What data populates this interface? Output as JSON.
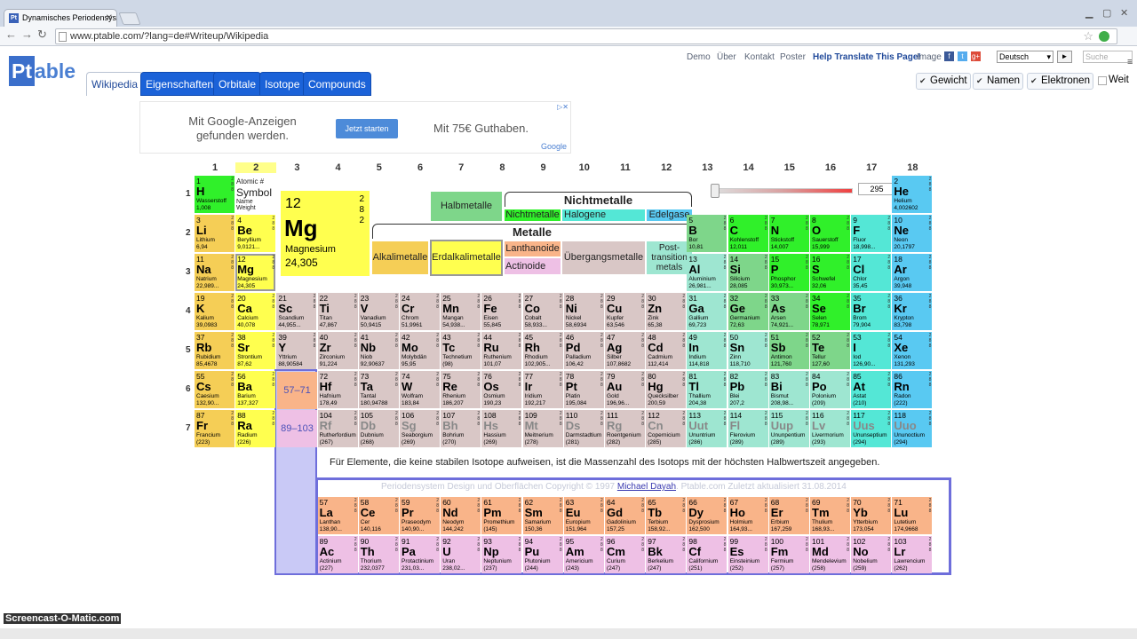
{
  "browser": {
    "tab_title": "Dynamisches Periodensys",
    "url": "www.ptable.com/?lang=de#Writeup/Wikipedia"
  },
  "logo": {
    "pt": "Pt",
    "rest": "able"
  },
  "nav_tabs": [
    "Wikipedia",
    "Eigenschaften",
    "Orbitale",
    "Isotope",
    "Compounds"
  ],
  "top_links": [
    "Demo",
    "Über",
    "Kontakt",
    "Poster",
    "Help Translate This Page!",
    "Image"
  ],
  "language": "Deutsch",
  "search_placeholder": "Suche",
  "toggles": [
    {
      "label": "Gewicht",
      "checked": true
    },
    {
      "label": "Namen",
      "checked": true
    },
    {
      "label": "Elektronen",
      "checked": true
    },
    {
      "label": "Weit",
      "checked": false
    }
  ],
  "ad": {
    "line1": "Mit Google-Anzeigen gefunden werden.",
    "button": "Jetzt starten",
    "line2": "Mit 75€ Guthaben.",
    "brand": "Google"
  },
  "groups": [
    "1",
    "2",
    "3",
    "4",
    "5",
    "6",
    "7",
    "8",
    "9",
    "10",
    "11",
    "12",
    "13",
    "14",
    "15",
    "16",
    "17",
    "18"
  ],
  "periods": [
    "1",
    "2",
    "3",
    "4",
    "5",
    "6",
    "7"
  ],
  "legend": {
    "atomic": "Atomic #",
    "symbol": "Symbol",
    "name": "Name",
    "weight": "Weight",
    "big_number": "12",
    "big_symbol": "Mg",
    "big_name": "Magnesium",
    "big_weight": "24,305",
    "big_shells": "2\n8\n2",
    "nichtmetalle": "Nichtmetalle",
    "metalle": "Metalle",
    "halbmetalle": "Halbmetalle",
    "nichtmetall": "Nichtmetalle",
    "halogene": "Halogene",
    "edelgase": "Edelgase",
    "alkali": "Alkalimetalle",
    "erdalkali": "Erdalkalimetalle",
    "lanthanoide": "Lanthanoide",
    "actinoide": "Actinoide",
    "uebergang": "Übergangsmetalle",
    "post": "Post-transition metals",
    "temp": "295"
  },
  "placeholders": [
    "57–71",
    "89–103"
  ],
  "note": "Für Elemente, die keine stabilen Isotope aufweisen, ist die Massenzahl des Isotops mit der höchsten Halbwertszeit angegeben.",
  "copyright": {
    "pre": "Periodensystem Design und Oberflächen Copyright © 1997",
    "author": "Michael Dayah",
    "post": ". Ptable.com Zuletzt aktualisiert 31.08.2014"
  },
  "watermark": "Screencast-O-Matic.com",
  "elements": [
    [
      "1",
      "H",
      "Wasserstoff",
      "1,008",
      1,
      1,
      "nm2",
      false
    ],
    [
      "2",
      "He",
      "Helium",
      "4,002602",
      18,
      1,
      "ng",
      false
    ],
    [
      "3",
      "Li",
      "Lithium",
      "6,94",
      1,
      2,
      "alk",
      false
    ],
    [
      "4",
      "Be",
      "Beryllium",
      "9,0121...",
      2,
      2,
      "ea",
      false
    ],
    [
      "5",
      "B",
      "Bor",
      "10,81",
      13,
      2,
      "ml",
      false
    ],
    [
      "6",
      "C",
      "Kohlenstoff",
      "12,011",
      14,
      2,
      "nm2",
      false
    ],
    [
      "7",
      "N",
      "Stickstoff",
      "14,007",
      15,
      2,
      "nm2",
      false
    ],
    [
      "8",
      "O",
      "Sauerstoff",
      "15,999",
      16,
      2,
      "nm2",
      false
    ],
    [
      "9",
      "F",
      "Fluor",
      "18,998...",
      17,
      2,
      "hal",
      false
    ],
    [
      "10",
      "Ne",
      "Neon",
      "20,1797",
      18,
      2,
      "ng",
      false
    ],
    [
      "11",
      "Na",
      "Natrium",
      "22,989...",
      1,
      3,
      "alk",
      false
    ],
    [
      "12",
      "Mg",
      "Magnesium",
      "24,305",
      2,
      3,
      "ea",
      false
    ],
    [
      "13",
      "Al",
      "Aluminium",
      "26,981...",
      13,
      3,
      "pt2",
      false
    ],
    [
      "14",
      "Si",
      "Silicium",
      "28,085",
      14,
      3,
      "ml",
      false
    ],
    [
      "15",
      "P",
      "Phosphor",
      "30,973...",
      15,
      3,
      "nm2",
      false
    ],
    [
      "16",
      "S",
      "Schwefel",
      "32,06",
      16,
      3,
      "nm2",
      false
    ],
    [
      "17",
      "Cl",
      "Chlor",
      "35,45",
      17,
      3,
      "hal",
      false
    ],
    [
      "18",
      "Ar",
      "Argon",
      "39,948",
      18,
      3,
      "ng",
      false
    ],
    [
      "19",
      "K",
      "Kalium",
      "39,0983",
      1,
      4,
      "alk",
      false
    ],
    [
      "20",
      "Ca",
      "Calcium",
      "40,078",
      2,
      4,
      "ea",
      false
    ],
    [
      "21",
      "Sc",
      "Scandium",
      "44,955...",
      3,
      4,
      "tm",
      false
    ],
    [
      "22",
      "Ti",
      "Titan",
      "47,867",
      4,
      4,
      "tm",
      false
    ],
    [
      "23",
      "V",
      "Vanadium",
      "50,9415",
      5,
      4,
      "tm",
      false
    ],
    [
      "24",
      "Cr",
      "Chrom",
      "51,9961",
      6,
      4,
      "tm",
      false
    ],
    [
      "25",
      "Mn",
      "Mangan",
      "54,938...",
      7,
      4,
      "tm",
      false
    ],
    [
      "26",
      "Fe",
      "Eisen",
      "55,845",
      8,
      4,
      "tm",
      false
    ],
    [
      "27",
      "Co",
      "Cobalt",
      "58,933...",
      9,
      4,
      "tm",
      false
    ],
    [
      "28",
      "Ni",
      "Nickel",
      "58,6934",
      10,
      4,
      "tm",
      false
    ],
    [
      "29",
      "Cu",
      "Kupfer",
      "63,546",
      11,
      4,
      "tm",
      false
    ],
    [
      "30",
      "Zn",
      "Zink",
      "65,38",
      12,
      4,
      "tm",
      false
    ],
    [
      "31",
      "Ga",
      "Gallium",
      "69,723",
      13,
      4,
      "pt2",
      false
    ],
    [
      "32",
      "Ge",
      "Germanium",
      "72,63",
      14,
      4,
      "ml",
      false
    ],
    [
      "33",
      "As",
      "Arsen",
      "74,921...",
      15,
      4,
      "ml",
      false
    ],
    [
      "34",
      "Se",
      "Selen",
      "78,971",
      16,
      4,
      "nm2",
      false
    ],
    [
      "35",
      "Br",
      "Brom",
      "79,904",
      17,
      4,
      "hal",
      false
    ],
    [
      "36",
      "Kr",
      "Krypton",
      "83,798",
      18,
      4,
      "ng",
      false
    ],
    [
      "37",
      "Rb",
      "Rubidium",
      "85,4678",
      1,
      5,
      "alk",
      false
    ],
    [
      "38",
      "Sr",
      "Strontium",
      "87,62",
      2,
      5,
      "ea",
      false
    ],
    [
      "39",
      "Y",
      "Yttrium",
      "88,90584",
      3,
      5,
      "tm",
      false
    ],
    [
      "40",
      "Zr",
      "Zirconium",
      "91,224",
      4,
      5,
      "tm",
      false
    ],
    [
      "41",
      "Nb",
      "Niob",
      "92,90637",
      5,
      5,
      "tm",
      false
    ],
    [
      "42",
      "Mo",
      "Molybdän",
      "95,95",
      6,
      5,
      "tm",
      false
    ],
    [
      "43",
      "Tc",
      "Technetium",
      "(98)",
      7,
      5,
      "tm",
      false
    ],
    [
      "44",
      "Ru",
      "Ruthenium",
      "101,07",
      8,
      5,
      "tm",
      false
    ],
    [
      "45",
      "Rh",
      "Rhodium",
      "102,905...",
      9,
      5,
      "tm",
      false
    ],
    [
      "46",
      "Pd",
      "Palladium",
      "106,42",
      10,
      5,
      "tm",
      false
    ],
    [
      "47",
      "Ag",
      "Silber",
      "107,8682",
      11,
      5,
      "tm",
      false
    ],
    [
      "48",
      "Cd",
      "Cadmium",
      "112,414",
      12,
      5,
      "tm",
      false
    ],
    [
      "49",
      "In",
      "Indium",
      "114,818",
      13,
      5,
      "pt2",
      false
    ],
    [
      "50",
      "Sn",
      "Zinn",
      "118,710",
      14,
      5,
      "pt2",
      false
    ],
    [
      "51",
      "Sb",
      "Antimon",
      "121,760",
      15,
      5,
      "ml",
      false
    ],
    [
      "52",
      "Te",
      "Tellur",
      "127,60",
      16,
      5,
      "ml",
      false
    ],
    [
      "53",
      "I",
      "Iod",
      "126,90...",
      17,
      5,
      "hal",
      false
    ],
    [
      "54",
      "Xe",
      "Xenon",
      "131,293",
      18,
      5,
      "ng",
      false
    ],
    [
      "55",
      "Cs",
      "Caesium",
      "132,90...",
      1,
      6,
      "alk",
      false
    ],
    [
      "56",
      "Ba",
      "Barium",
      "137,327",
      2,
      6,
      "ea",
      false
    ],
    [
      "72",
      "Hf",
      "Hafnium",
      "178,49",
      4,
      6,
      "tm",
      false
    ],
    [
      "73",
      "Ta",
      "Tantal",
      "180,94788",
      5,
      6,
      "tm",
      false
    ],
    [
      "74",
      "W",
      "Wolfram",
      "183,84",
      6,
      6,
      "tm",
      false
    ],
    [
      "75",
      "Re",
      "Rhenium",
      "186,207",
      7,
      6,
      "tm",
      false
    ],
    [
      "76",
      "Os",
      "Osmium",
      "190,23",
      8,
      6,
      "tm",
      false
    ],
    [
      "77",
      "Ir",
      "Iridium",
      "192,217",
      9,
      6,
      "tm",
      false
    ],
    [
      "78",
      "Pt",
      "Platin",
      "195,084",
      10,
      6,
      "tm",
      false
    ],
    [
      "79",
      "Au",
      "Gold",
      "196,96...",
      11,
      6,
      "tm",
      false
    ],
    [
      "80",
      "Hg",
      "Quecksilber",
      "200,59",
      12,
      6,
      "tm",
      false
    ],
    [
      "81",
      "Tl",
      "Thallium",
      "204,38",
      13,
      6,
      "pt2",
      false
    ],
    [
      "82",
      "Pb",
      "Blei",
      "207,2",
      14,
      6,
      "pt2",
      false
    ],
    [
      "83",
      "Bi",
      "Bismut",
      "208,98...",
      15,
      6,
      "pt2",
      false
    ],
    [
      "84",
      "Po",
      "Polonium",
      "(209)",
      16,
      6,
      "pt2",
      false
    ],
    [
      "85",
      "At",
      "Astat",
      "(210)",
      17,
      6,
      "hal",
      false
    ],
    [
      "86",
      "Rn",
      "Radon",
      "(222)",
      18,
      6,
      "ng",
      false
    ],
    [
      "87",
      "Fr",
      "Francium",
      "(223)",
      1,
      7,
      "alk",
      false
    ],
    [
      "88",
      "Ra",
      "Radium",
      "(226)",
      2,
      7,
      "ea",
      false
    ],
    [
      "104",
      "Rf",
      "Rutherfordium",
      "(267)",
      4,
      7,
      "tm",
      true
    ],
    [
      "105",
      "Db",
      "Dubnium",
      "(268)",
      5,
      7,
      "tm",
      true
    ],
    [
      "106",
      "Sg",
      "Seaborgium",
      "(269)",
      6,
      7,
      "tm",
      true
    ],
    [
      "107",
      "Bh",
      "Bohrium",
      "(270)",
      7,
      7,
      "tm",
      true
    ],
    [
      "108",
      "Hs",
      "Hassium",
      "(269)",
      8,
      7,
      "tm",
      true
    ],
    [
      "109",
      "Mt",
      "Meitnerium",
      "(278)",
      9,
      7,
      "tm",
      true
    ],
    [
      "110",
      "Ds",
      "Darmstadtium",
      "(281)",
      10,
      7,
      "tm",
      true
    ],
    [
      "111",
      "Rg",
      "Roentgenium",
      "(282)",
      11,
      7,
      "tm",
      true
    ],
    [
      "112",
      "Cn",
      "Copernicium",
      "(285)",
      12,
      7,
      "tm",
      true
    ],
    [
      "113",
      "Uut",
      "Ununtrium",
      "(286)",
      13,
      7,
      "pt2",
      true
    ],
    [
      "114",
      "Fl",
      "Flerovium",
      "(289)",
      14,
      7,
      "pt2",
      true
    ],
    [
      "115",
      "Uup",
      "Ununpentium",
      "(289)",
      15,
      7,
      "pt2",
      true
    ],
    [
      "116",
      "Lv",
      "Livermorium",
      "(293)",
      16,
      7,
      "pt2",
      true
    ],
    [
      "117",
      "Uus",
      "Ununseptium",
      "(294)",
      17,
      7,
      "hal",
      true
    ],
    [
      "118",
      "Uuo",
      "Ununoctium",
      "(294)",
      18,
      7,
      "ng",
      true
    ],
    [
      "57",
      "La",
      "Lanthan",
      "138,90...",
      4,
      9,
      "la",
      false
    ],
    [
      "58",
      "Ce",
      "Cer",
      "140,116",
      5,
      9,
      "la",
      false
    ],
    [
      "59",
      "Pr",
      "Praseodym",
      "140,90...",
      6,
      9,
      "la",
      false
    ],
    [
      "60",
      "Nd",
      "Neodym",
      "144,242",
      7,
      9,
      "la",
      false
    ],
    [
      "61",
      "Pm",
      "Promethium",
      "(145)",
      8,
      9,
      "la",
      false
    ],
    [
      "62",
      "Sm",
      "Samarium",
      "150,36",
      9,
      9,
      "la",
      false
    ],
    [
      "63",
      "Eu",
      "Europium",
      "151,964",
      10,
      9,
      "la",
      false
    ],
    [
      "64",
      "Gd",
      "Gadolinium",
      "157,25",
      11,
      9,
      "la",
      false
    ],
    [
      "65",
      "Tb",
      "Terbium",
      "158,92...",
      12,
      9,
      "la",
      false
    ],
    [
      "66",
      "Dy",
      "Dysprosium",
      "162,500",
      13,
      9,
      "la",
      false
    ],
    [
      "67",
      "Ho",
      "Holmium",
      "164,93...",
      14,
      9,
      "la",
      false
    ],
    [
      "68",
      "Er",
      "Erbium",
      "167,259",
      15,
      9,
      "la",
      false
    ],
    [
      "69",
      "Tm",
      "Thulium",
      "168,93...",
      16,
      9,
      "la",
      false
    ],
    [
      "70",
      "Yb",
      "Ytterbium",
      "173,054",
      17,
      9,
      "la",
      false
    ],
    [
      "71",
      "Lu",
      "Lutetium",
      "174,9668",
      18,
      9,
      "la",
      false
    ],
    [
      "89",
      "Ac",
      "Actinium",
      "(227)",
      4,
      10,
      "ac",
      false
    ],
    [
      "90",
      "Th",
      "Thorium",
      "232,0377",
      5,
      10,
      "ac",
      false
    ],
    [
      "91",
      "Pa",
      "Protactinium",
      "231,03...",
      6,
      10,
      "ac",
      false
    ],
    [
      "92",
      "U",
      "Uran",
      "238,02...",
      7,
      10,
      "ac",
      false
    ],
    [
      "93",
      "Np",
      "Neptunium",
      "(237)",
      8,
      10,
      "ac",
      false
    ],
    [
      "94",
      "Pu",
      "Plutonium",
      "(244)",
      9,
      10,
      "ac",
      false
    ],
    [
      "95",
      "Am",
      "Americium",
      "(243)",
      10,
      10,
      "ac",
      false
    ],
    [
      "96",
      "Cm",
      "Curium",
      "(247)",
      11,
      10,
      "ac",
      false
    ],
    [
      "97",
      "Bk",
      "Berkelium",
      "(247)",
      12,
      10,
      "ac",
      false
    ],
    [
      "98",
      "Cf",
      "Californium",
      "(251)",
      13,
      10,
      "ac",
      false
    ],
    [
      "99",
      "Es",
      "Einsteinium",
      "(252)",
      14,
      10,
      "ac",
      false
    ],
    [
      "100",
      "Fm",
      "Fermium",
      "(257)",
      15,
      10,
      "ac",
      false
    ],
    [
      "101",
      "Md",
      "Mendelevium",
      "(258)",
      16,
      10,
      "ac",
      false
    ],
    [
      "102",
      "No",
      "Nobelium",
      "(259)",
      17,
      10,
      "ac",
      false
    ],
    [
      "103",
      "Lr",
      "Lawrencium",
      "(262)",
      18,
      10,
      "ac",
      false
    ]
  ]
}
